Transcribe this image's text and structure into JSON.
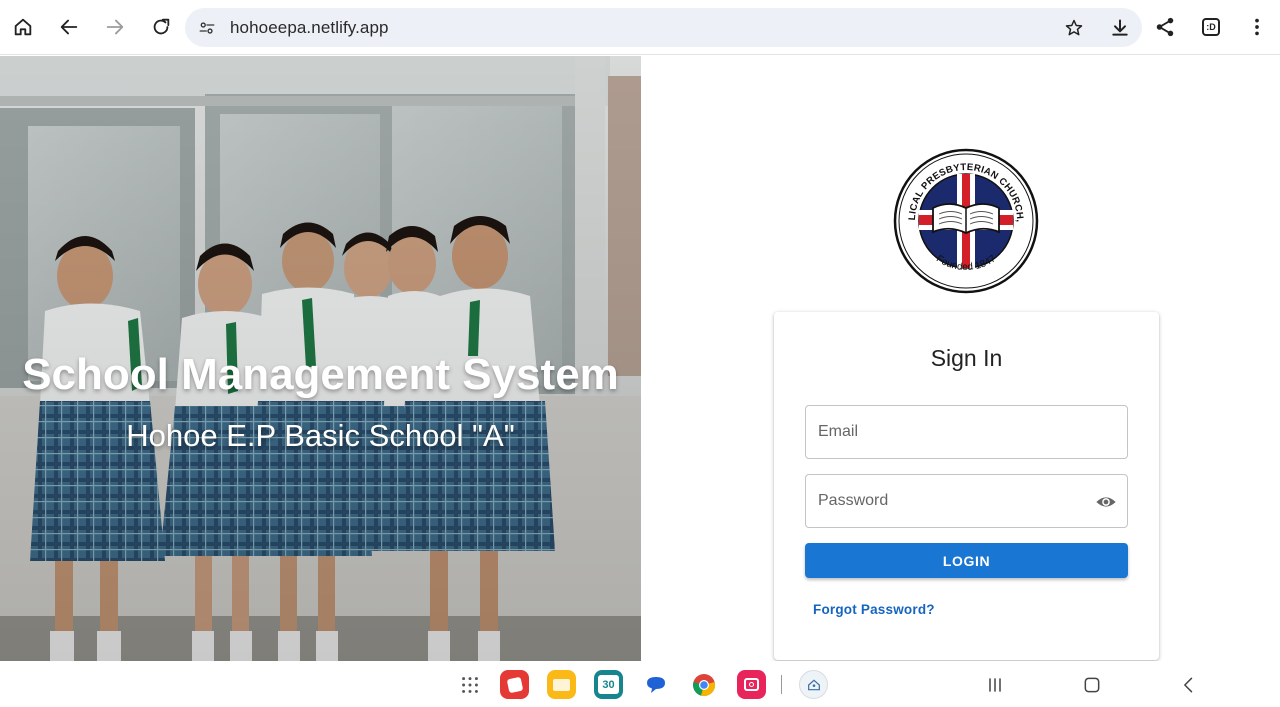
{
  "browser": {
    "url": "hohoeepa.netlify.app",
    "tab_count": ":D"
  },
  "hero": {
    "title": "School Management System",
    "subtitle": "Hohoe E.P Basic School \"A\""
  },
  "logo": {
    "top_text": "EVANGELICAL PRESBYTERIAN CHURCH, GHANA",
    "bottom_text": "Founded 1847"
  },
  "signin": {
    "title": "Sign In",
    "email_placeholder": "Email",
    "password_placeholder": "Password",
    "login_label": "LOGIN",
    "forgot_label": "Forgot Password?"
  },
  "dock": {
    "calendar_day": "30",
    "apps": [
      "app-drawer",
      "red-app",
      "my-files",
      "calendar",
      "messages",
      "chrome",
      "camera",
      "school-app"
    ]
  },
  "colors": {
    "primary": "#1976d2",
    "link": "#1565c0",
    "omnibox": "#edf0f6"
  }
}
